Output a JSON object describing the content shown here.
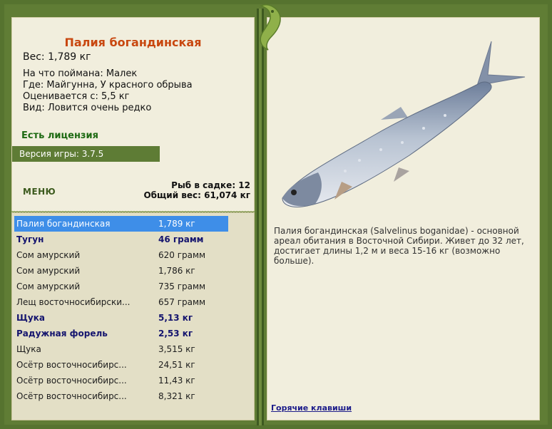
{
  "fish": {
    "title": "Палия богандинская",
    "weight": "Вес: 1,789 кг",
    "caught_on": "На что поймана: Малек",
    "where": "Где: Майгунна, У красного обрыва",
    "estimated": "Оценивается с: 5,5 кг",
    "view": "Вид: Ловится очень редко"
  },
  "license": "Есть лицензия",
  "version": "Версия игры: 3.7.5",
  "menu_label": "МЕНЮ",
  "stats": {
    "in_cage": "Рыб в садке: 12",
    "total_weight": "Общий вес: 61,074 кг"
  },
  "catch_list": [
    {
      "name": "Палия богандинская",
      "weight": "1,789 кг",
      "selected": true,
      "bold": false
    },
    {
      "name": "Тугун",
      "weight": "46 грамм",
      "selected": false,
      "bold": true
    },
    {
      "name": "Сом амурский",
      "weight": "620 грамм",
      "selected": false,
      "bold": false
    },
    {
      "name": "Сом амурский",
      "weight": "1,786 кг",
      "selected": false,
      "bold": false
    },
    {
      "name": "Сом амурский",
      "weight": "735 грамм",
      "selected": false,
      "bold": false
    },
    {
      "name": "Лещ восточносибирски...",
      "weight": "657 грамм",
      "selected": false,
      "bold": false
    },
    {
      "name": "Щука",
      "weight": "5,13 кг",
      "selected": false,
      "bold": true
    },
    {
      "name": "Радужная форель",
      "weight": "2,53 кг",
      "selected": false,
      "bold": true
    },
    {
      "name": "Щука",
      "weight": "3,515 кг",
      "selected": false,
      "bold": false
    },
    {
      "name": "Осётр восточносибирс...",
      "weight": "24,51 кг",
      "selected": false,
      "bold": false
    },
    {
      "name": "Осётр восточносибирс...",
      "weight": "11,43 кг",
      "selected": false,
      "bold": false
    },
    {
      "name": "Осётр восточносибирс...",
      "weight": "8,321 кг",
      "selected": false,
      "bold": false
    }
  ],
  "description": "Палия богандинская (Salvelinus boganidae) - основной ареал обитания в Восточной Сибири. Живет до 32 лет, достигает длины 1,2 м и веса 15-16 кг (возможно больше).",
  "hotkeys": "Горячие клавиши",
  "colors": {
    "frame": "#56732f",
    "panel": "#f1eedd",
    "title": "#c8470f",
    "license": "#1e6a13",
    "selected_row": "#3e8ee8",
    "bold_row": "#14146e"
  }
}
